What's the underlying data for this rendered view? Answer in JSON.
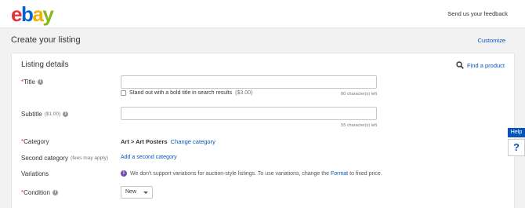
{
  "header": {
    "logo": {
      "l1": "e",
      "l2": "b",
      "l3": "a",
      "l4": "y"
    },
    "feedback_link": "Send us your feedback"
  },
  "page": {
    "title": "Create your listing",
    "customize_link": "Customize"
  },
  "listing": {
    "section_title": "Listing details",
    "find_product": "Find a product",
    "title_field": {
      "required_mark": "*",
      "label": "Title",
      "value": "",
      "counter": "80 character(s) left",
      "bold_option_label": "Stand out with a bold title in search results",
      "bold_option_price": "($3.00)",
      "bold_option_checked": false
    },
    "subtitle_field": {
      "label": "Subtitle",
      "price": "($1.00)",
      "value": "",
      "counter": "55 character(s) left"
    },
    "category": {
      "required_mark": "*",
      "label": "Category",
      "value": "Art > Art Posters",
      "change_link": "Change category"
    },
    "second_category": {
      "label": "Second category",
      "note": "(fees may apply)",
      "add_link": "Add a second category"
    },
    "variations": {
      "label": "Variations",
      "message_pre": "We don't support variations for auction-style listings. To use variations, change the",
      "message_link": "Format",
      "message_post": "to fixed price."
    },
    "condition": {
      "required_mark": "*",
      "label": "Condition",
      "selected": "New"
    }
  },
  "help": {
    "tab_label": "Help",
    "question_mark": "?"
  }
}
